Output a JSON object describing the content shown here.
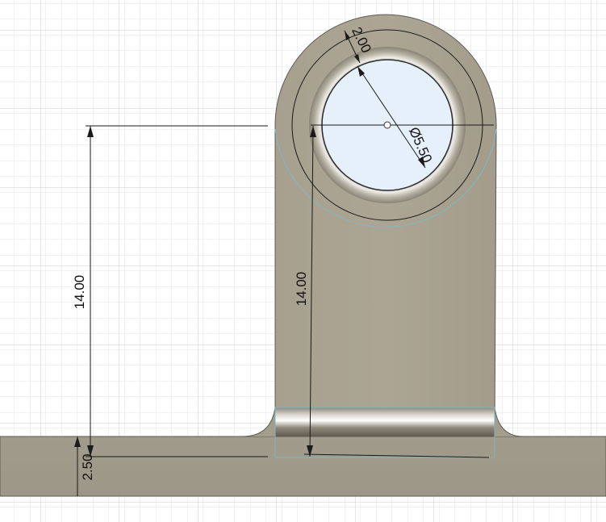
{
  "dimensions": {
    "left_height": "14.00",
    "inner_height": "14.00",
    "hole_diameter": "Ø5.50",
    "ring_width": "2.00",
    "base_thickness": "2.50"
  },
  "colors": {
    "background": "#ffffff",
    "grid_minor": "#e3e6ea",
    "grid_major": "#c9ced4",
    "part_fill": "#a9a292",
    "part_edge": "#5c5a52",
    "hole_fill": "#e6f0fb",
    "dimension_line": "#1a1a1a",
    "construction_line": "#7fb8c4"
  }
}
